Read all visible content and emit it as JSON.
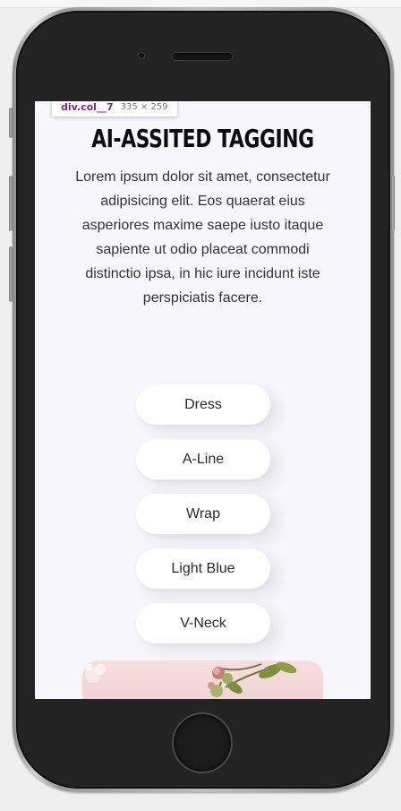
{
  "devtools": {
    "selector": "div.col__7",
    "dimensions": "335 × 259"
  },
  "page": {
    "title": "AI-ASSITED TAGGING",
    "description": "Lorem ipsum dolor sit amet, consectetur adipisicing elit. Eos quaerat eius asperiores maxime saepe iusto itaque sapiente ut odio placeat commodi distinctio ipsa, in hic iure incidunt iste perspiciatis facere."
  },
  "tags": [
    "Dress",
    "A-Line",
    "Wrap",
    "Light Blue",
    "V-Neck"
  ],
  "colors": {
    "screen_background": "#f7f6fd",
    "pill_background": "#ffffff",
    "title_text": "#0d0d0d",
    "body_text": "#333333",
    "devtools_selector": "#8b1f8d",
    "phone_body": "#232323"
  },
  "icons": {
    "camera": "camera-icon",
    "speaker": "speaker-icon",
    "home_button": "home-button-icon"
  }
}
